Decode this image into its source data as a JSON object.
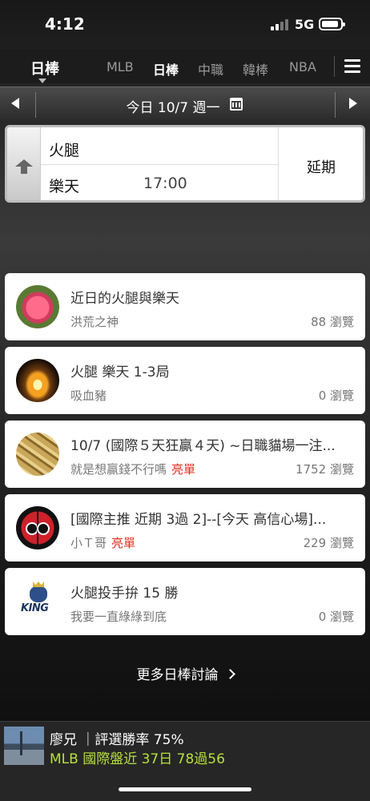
{
  "status_bar": {
    "time": "4:12",
    "network": "5G"
  },
  "sport_selector": {
    "current": "日棒"
  },
  "tabs": [
    {
      "label": "MLB",
      "active": false
    },
    {
      "label": "日棒",
      "active": true
    },
    {
      "label": "中職",
      "active": false
    },
    {
      "label": "韓棒",
      "active": false
    },
    {
      "label": "NBA",
      "active": false
    }
  ],
  "date_bar": {
    "label": "今日 10/7 週一"
  },
  "game": {
    "away_team": "火腿",
    "home_team": "樂天",
    "time": "17:00",
    "status": "延期"
  },
  "posts": [
    {
      "title": "近日的火腿與樂天",
      "author": "洪荒之神",
      "badge": "",
      "views": "88 瀏覽",
      "avatar": "flower"
    },
    {
      "title": "火腿 樂天 1-3局",
      "author": "吸血豬",
      "badge": "",
      "views": "0 瀏覽",
      "avatar": "candle"
    },
    {
      "title": "10/7 (國際５天狂贏４天) ~日職貓場一注...",
      "author": "就是想贏錢不行嗎",
      "badge": "亮單",
      "views": "1752 瀏覽",
      "avatar": "gold"
    },
    {
      "title": "[國際主推 近期 3過 2]--[今天 高信心場]...",
      "author": "小Ｔ哥",
      "badge": "亮單",
      "views": "229 瀏覽",
      "avatar": "mask"
    },
    {
      "title": "火腿投手拚 15 勝",
      "author": "我要一直綠綠到底",
      "badge": "",
      "views": "0 瀏覽",
      "avatar": "king"
    }
  ],
  "more_link": "更多日棒討論",
  "promo": {
    "line1": "廖兄 ｜評選勝率 75%",
    "line2": "MLB 國際盤近 37日 78過56",
    "accent_color": "#b8e03a"
  },
  "king_logo_text": "KING"
}
